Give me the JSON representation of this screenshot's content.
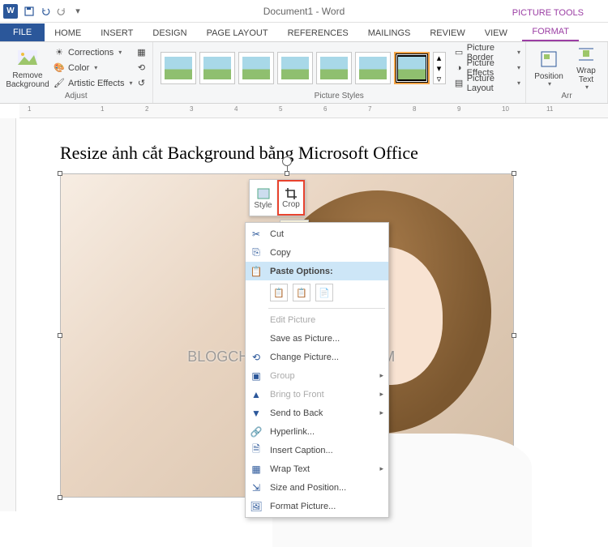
{
  "titlebar": {
    "doc_title": "Document1 - Word",
    "tools_tab": "PICTURE TOOLS"
  },
  "tabs": {
    "file": "FILE",
    "home": "HOME",
    "insert": "INSERT",
    "design": "DESIGN",
    "page_layout": "PAGE LAYOUT",
    "references": "REFERENCES",
    "mailings": "MAILINGS",
    "review": "REVIEW",
    "view": "VIEW",
    "format": "FORMAT"
  },
  "ribbon": {
    "remove_bg": "Remove Background",
    "corrections": "Corrections",
    "color": "Color",
    "artistic": "Artistic Effects",
    "adjust_label": "Adjust",
    "styles_label": "Picture Styles",
    "pic_border": "Picture Border",
    "pic_effects": "Picture Effects",
    "pic_layout": "Picture Layout",
    "position": "Position",
    "wrap": "Wrap Text",
    "arrange_label": "Arr"
  },
  "document": {
    "heading": "Resize ảnh cắt Background bằng Microsoft Office",
    "watermark": "BLOGCHIASEKIENTHUC.COM"
  },
  "mini_toolbar": {
    "style": "Style",
    "crop": "Crop",
    "tooltip": "Crop"
  },
  "context_menu": {
    "cut": "Cut",
    "copy": "Copy",
    "paste_options": "Paste Options:",
    "edit_picture": "Edit Picture",
    "save_as_picture": "Save as Picture...",
    "change_picture": "Change Picture...",
    "group": "Group",
    "bring_to_front": "Bring to Front",
    "send_to_back": "Send to Back",
    "hyperlink": "Hyperlink...",
    "insert_caption": "Insert Caption...",
    "wrap_text": "Wrap Text",
    "size_position": "Size and Position...",
    "format_picture": "Format Picture..."
  },
  "ruler": {
    "marks": [
      "1",
      "",
      "1",
      "2",
      "3",
      "4",
      "5",
      "6",
      "7",
      "8",
      "9",
      "10",
      "11"
    ]
  }
}
